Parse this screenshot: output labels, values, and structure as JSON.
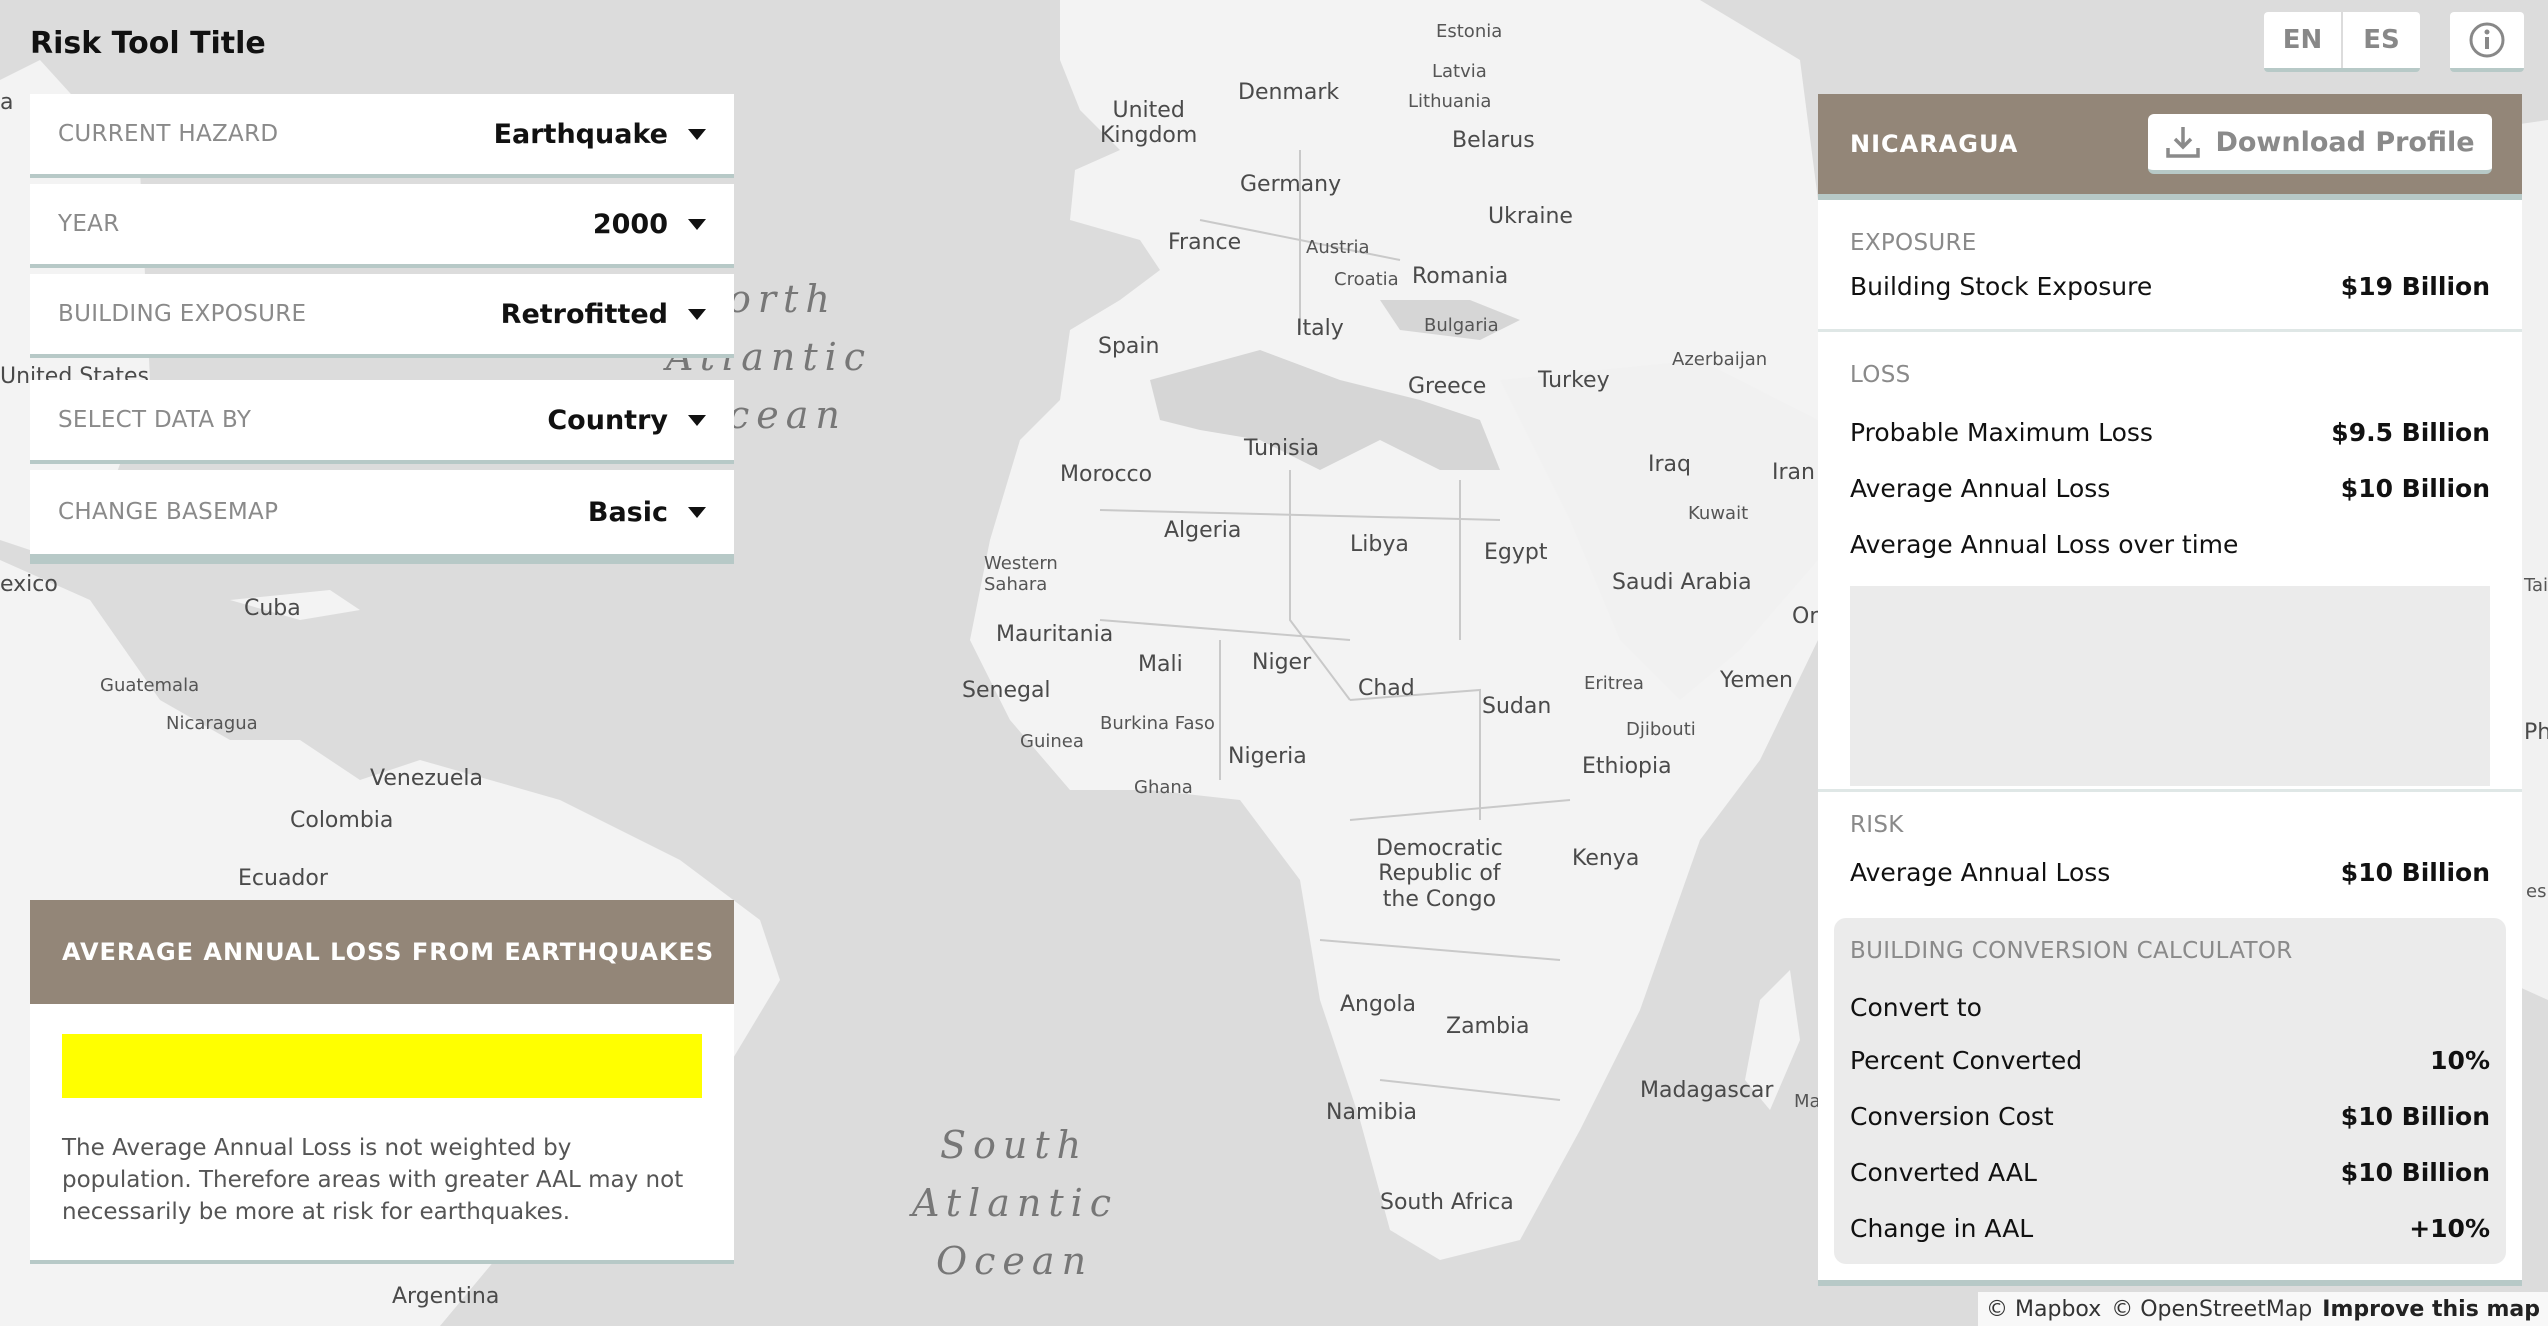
{
  "app": {
    "title": "Risk Tool Title"
  },
  "controls": [
    {
      "label": "CURRENT HAZARD",
      "value": "Earthquake"
    },
    {
      "label": "YEAR",
      "value": "2000"
    },
    {
      "label": "BUILDING EXPOSURE",
      "value": "Retrofitted"
    },
    {
      "label": "SELECT DATA BY",
      "value": "Country"
    },
    {
      "label": "CHANGE BASEMAP",
      "value": "Basic"
    }
  ],
  "legend": {
    "title": "AVERAGE ANNUAL LOSS FROM EARTHQUAKES",
    "color": "#ffff00",
    "note": "The Average Annual Loss is not weighted by population. Therefore areas with greater AAL may not necessarily be more at risk for earthquakes."
  },
  "lang": {
    "en": "EN",
    "es": "ES"
  },
  "icons": {
    "info": "info-icon",
    "download": "download-icon",
    "caret": "caret-down-icon"
  },
  "colors": {
    "header": "#938678",
    "accent_border": "#b7c9c7",
    "legend_swatch": "#ffff00"
  },
  "panel": {
    "country": "NICARAGUA",
    "download_label": "Download Profile",
    "exposure": {
      "title": "EXPOSURE",
      "rows": [
        {
          "k": "Building Stock Exposure",
          "v": "$19 Billion"
        }
      ]
    },
    "loss": {
      "title": "LOSS",
      "rows": [
        {
          "k": "Probable Maximum Loss",
          "v": "$9.5 Billion"
        },
        {
          "k": "Average Annual Loss",
          "v": "$10 Billion"
        }
      ],
      "over_time_label": "Average Annual Loss over time"
    },
    "risk": {
      "title": "RISK",
      "rows": [
        {
          "k": "Average Annual Loss",
          "v": "$10 Billion"
        }
      ]
    },
    "calculator": {
      "title": "BUILDING CONVERSION CALCULATOR",
      "convert_to_label": "Convert to",
      "rows": [
        {
          "k": "Percent Converted",
          "v": "10%"
        },
        {
          "k": "Conversion Cost",
          "v": "$10 Billion"
        },
        {
          "k": "Converted AAL",
          "v": "$10 Billion"
        },
        {
          "k": "Change in AAL",
          "v": "+10%"
        }
      ]
    }
  },
  "map": {
    "oceans": {
      "north_atlantic_1": "orth",
      "north_atlantic_2": "Atlantic",
      "north_atlantic_3": "cean",
      "south_atlantic_1": "South",
      "south_atlantic_2": "Atlantic",
      "south_atlantic_3": "Ocean"
    },
    "labels": {
      "estonia": "Estonia",
      "latvia": "Latvia",
      "lithuania": "Lithuania",
      "denmark": "Denmark",
      "united_kingdom": "United\nKingdom",
      "belarus": "Belarus",
      "germany": "Germany",
      "ukraine": "Ukraine",
      "france": "France",
      "austria": "Austria",
      "croatia": "Croatia",
      "romania": "Romania",
      "italy": "Italy",
      "bulgaria": "Bulgaria",
      "spain": "Spain",
      "greece": "Greece",
      "turkey": "Turkey",
      "azerbaijan": "Azerbaijan",
      "tunisia": "Tunisia",
      "morocco": "Morocco",
      "iraq": "Iraq",
      "iran": "Iran",
      "kuwait": "Kuwait",
      "algeria": "Algeria",
      "libya": "Libya",
      "egypt": "Egypt",
      "western_sahara": "Western\nSahara",
      "saudi_arabia": "Saudi Arabia",
      "mauritania": "Mauritania",
      "mali": "Mali",
      "niger": "Niger",
      "chad": "Chad",
      "eritrea": "Eritrea",
      "yemen": "Yemen",
      "senegal": "Senegal",
      "sudan": "Sudan",
      "burkina_faso": "Burkina Faso",
      "djibouti": "Djibouti",
      "guinea": "Guinea",
      "nigeria": "Nigeria",
      "ethiopia": "Ethiopia",
      "ghana": "Ghana",
      "drc": "Democratic\nRepublic of\nthe Congo",
      "kenya": "Kenya",
      "angola": "Angola",
      "zambia": "Zambia",
      "madagascar": "Madagascar",
      "namibia": "Namibia",
      "south_africa": "South Africa",
      "united_states": "United States",
      "mexico": "exico",
      "cuba": "Cuba",
      "guatemala": "Guatemala",
      "nicaragua": "Nicaragua",
      "venezuela": "Venezuela",
      "colombia": "Colombia",
      "ecuador": "Ecuador",
      "argentina": "Argentina",
      "edge_a": "a",
      "edge_or": "Or",
      "edge_ma": "Ma",
      "edge_tai": "Tai",
      "edge_phi": "Phi",
      "edge_esi": "esi"
    }
  },
  "attribution": {
    "mapbox": "© Mapbox",
    "osm": "© OpenStreetMap",
    "improve": "Improve this map"
  }
}
